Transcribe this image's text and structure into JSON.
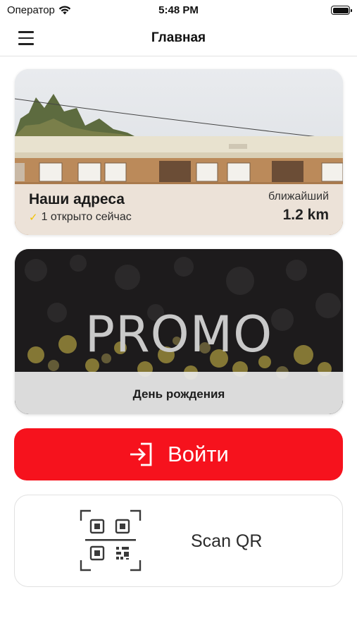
{
  "status_bar": {
    "carrier": "Оператор",
    "time": "5:48 PM"
  },
  "nav": {
    "title": "Главная",
    "menu_icon": "hamburger-menu-icon"
  },
  "address_card": {
    "title": "Наши адреса",
    "open_now": "1 открыто сейчас",
    "nearest_label": "ближайший",
    "distance": "1.2 km",
    "check_color": "#f2c300"
  },
  "promo_card": {
    "banner_text": "PROMO",
    "caption": "День рождения"
  },
  "login_button": {
    "label": "Войти",
    "icon": "login-arrow-icon",
    "color": "#f6121d"
  },
  "scan_card": {
    "label": "Scan QR",
    "icon": "qr-code-icon"
  }
}
